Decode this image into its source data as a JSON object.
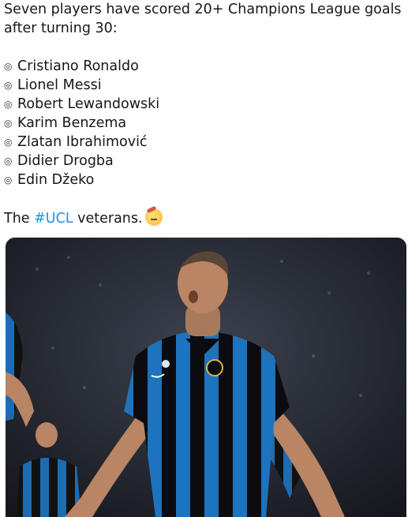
{
  "tweet": {
    "intro_line1": "Seven players have scored 20+ Champions League goals",
    "intro_line2": "after turning 30:",
    "bullet_glyph": "◎",
    "players": [
      "Cristiano Ronaldo",
      "Lionel Messi",
      "Robert Lewandowski",
      "Karim Benzema",
      "Zlatan Ibrahimović",
      "Didier Drogba",
      "Edin Džeko"
    ],
    "outro_prefix": "The ",
    "hashtag": "#UCL",
    "outro_suffix": " veterans.",
    "emoji": "saluting-face-emoji"
  },
  "media": {
    "kind": "photo",
    "subject": "footballer-celebrating",
    "colors": {
      "kit_blue": "#1e73be",
      "kit_black": "#0c0c10",
      "stadium": "#22262e"
    }
  },
  "colors": {
    "text": "#14171a",
    "link": "#1b95e0",
    "background": "#ffffff"
  }
}
